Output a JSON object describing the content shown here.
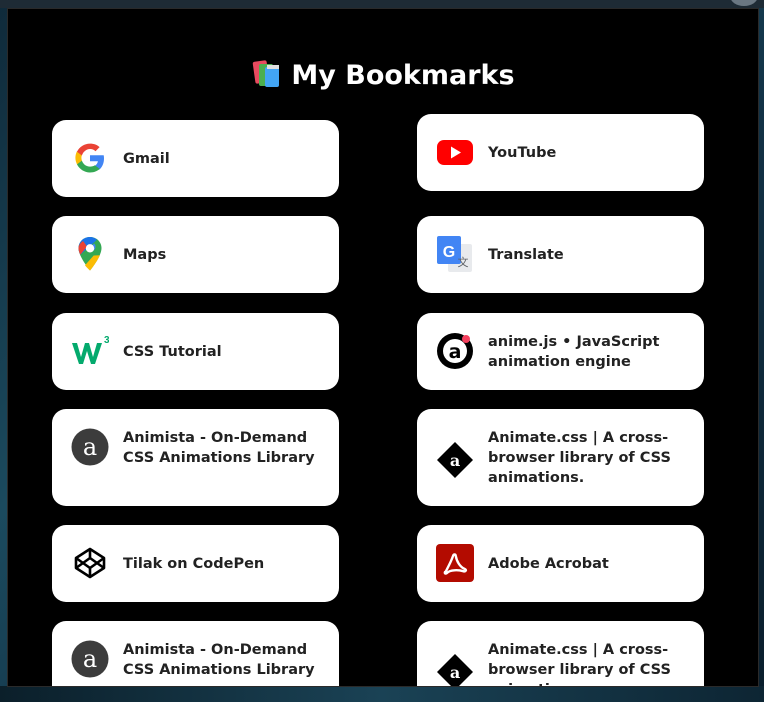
{
  "page": {
    "title": "My Bookmarks"
  },
  "bookmarks": [
    {
      "label": "Gmail",
      "icon": "google-g-icon"
    },
    {
      "label": "YouTube",
      "icon": "youtube-icon"
    },
    {
      "label": "Maps",
      "icon": "google-maps-pin-icon"
    },
    {
      "label": "Translate",
      "icon": "google-translate-icon"
    },
    {
      "label": "CSS Tutorial",
      "icon": "w3schools-icon"
    },
    {
      "label": "anime.js • JavaScript animation engine",
      "icon": "animejs-icon"
    },
    {
      "label": "Animista - On-Demand CSS Animations Library",
      "icon": "animista-icon"
    },
    {
      "label": "Animate.css | A cross-browser library of CSS animations.",
      "icon": "animatecss-icon"
    },
    {
      "label": "Tilak on CodePen",
      "icon": "codepen-icon"
    },
    {
      "label": "Adobe Acrobat",
      "icon": "adobe-acrobat-icon"
    },
    {
      "label": "Animista - On-Demand CSS Animations Library",
      "icon": "animista-icon"
    },
    {
      "label": "Animate.css | A cross-browser library of CSS animations.",
      "icon": "animatecss-icon"
    }
  ],
  "colors": {
    "popup_background": "#000000",
    "card_background": "#ffffff",
    "title_text": "#ffffff",
    "card_text": "#222222"
  }
}
